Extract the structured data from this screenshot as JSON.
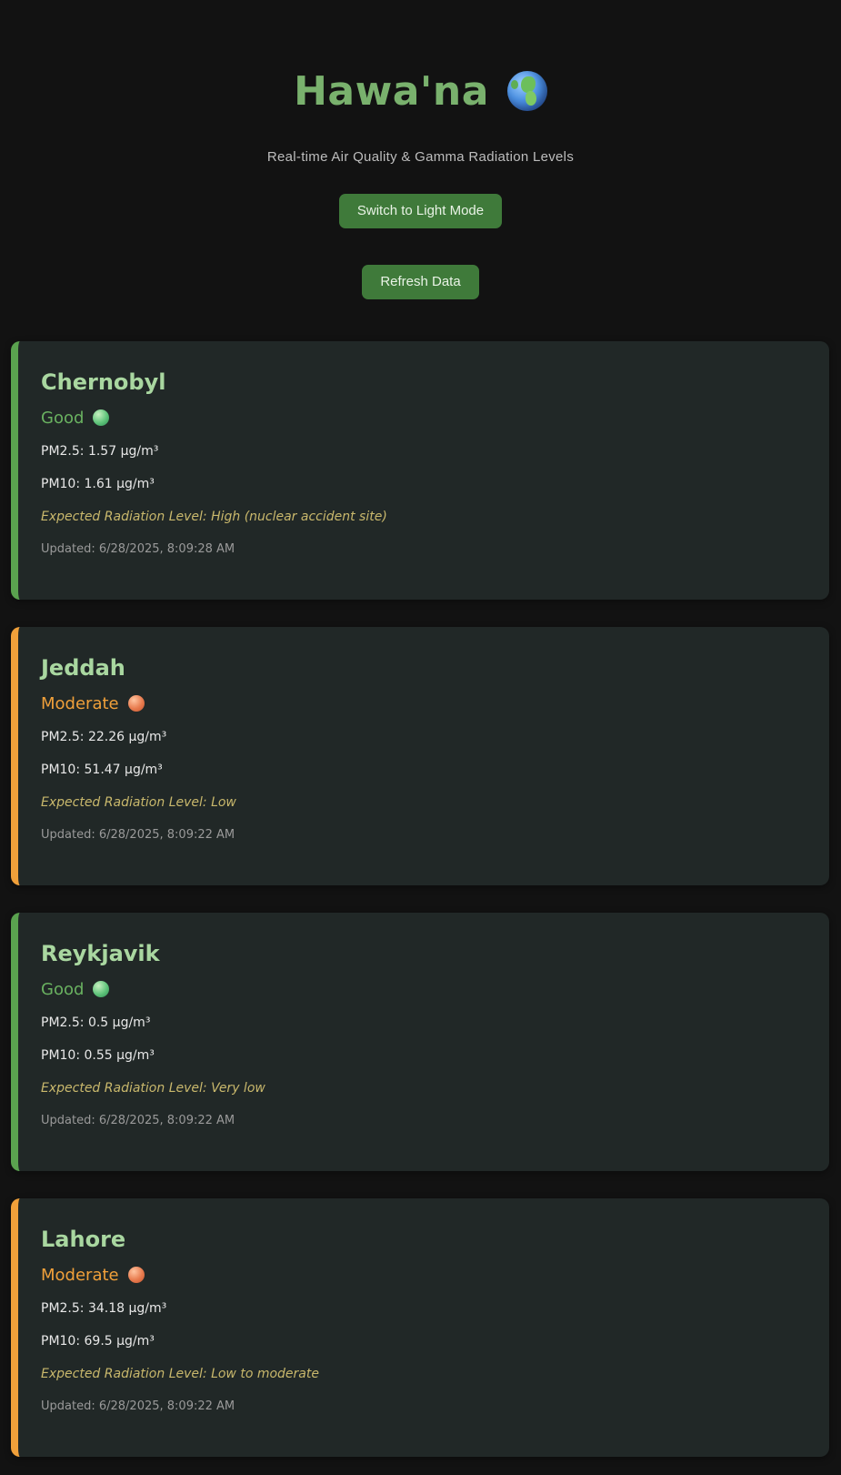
{
  "header": {
    "title": "Hawa'na",
    "globe_icon": "globe-europe-africa-icon",
    "subtitle": "Real-time Air Quality & Gamma Radiation Levels",
    "theme_button_label": "Switch to Light Mode",
    "refresh_button_label": "Refresh Data"
  },
  "colors": {
    "background": "#121212",
    "card_background": "#212827",
    "good": "#69b160",
    "moderate": "#f0a03a",
    "accent_button": "#3f7a3a",
    "radiation_text": "#c9b86c"
  },
  "cities": [
    {
      "name": "Chernobyl",
      "status": "Good",
      "pm25": "PM2.5: 1.57 µg/m³",
      "pm10": "PM10: 1.61 µg/m³",
      "radiation": "Expected Radiation Level: High (nuclear accident site)",
      "updated": "Updated: 6/28/2025, 8:09:28 AM"
    },
    {
      "name": "Jeddah",
      "status": "Moderate",
      "pm25": "PM2.5: 22.26 µg/m³",
      "pm10": "PM10: 51.47 µg/m³",
      "radiation": "Expected Radiation Level: Low",
      "updated": "Updated: 6/28/2025, 8:09:22 AM"
    },
    {
      "name": "Reykjavik",
      "status": "Good",
      "pm25": "PM2.5: 0.5 µg/m³",
      "pm10": "PM10: 0.55 µg/m³",
      "radiation": "Expected Radiation Level: Very low",
      "updated": "Updated: 6/28/2025, 8:09:22 AM"
    },
    {
      "name": "Lahore",
      "status": "Moderate",
      "pm25": "PM2.5: 34.18 µg/m³",
      "pm10": "PM10: 69.5 µg/m³",
      "radiation": "Expected Radiation Level: Low to moderate",
      "updated": "Updated: 6/28/2025, 8:09:22 AM"
    }
  ]
}
